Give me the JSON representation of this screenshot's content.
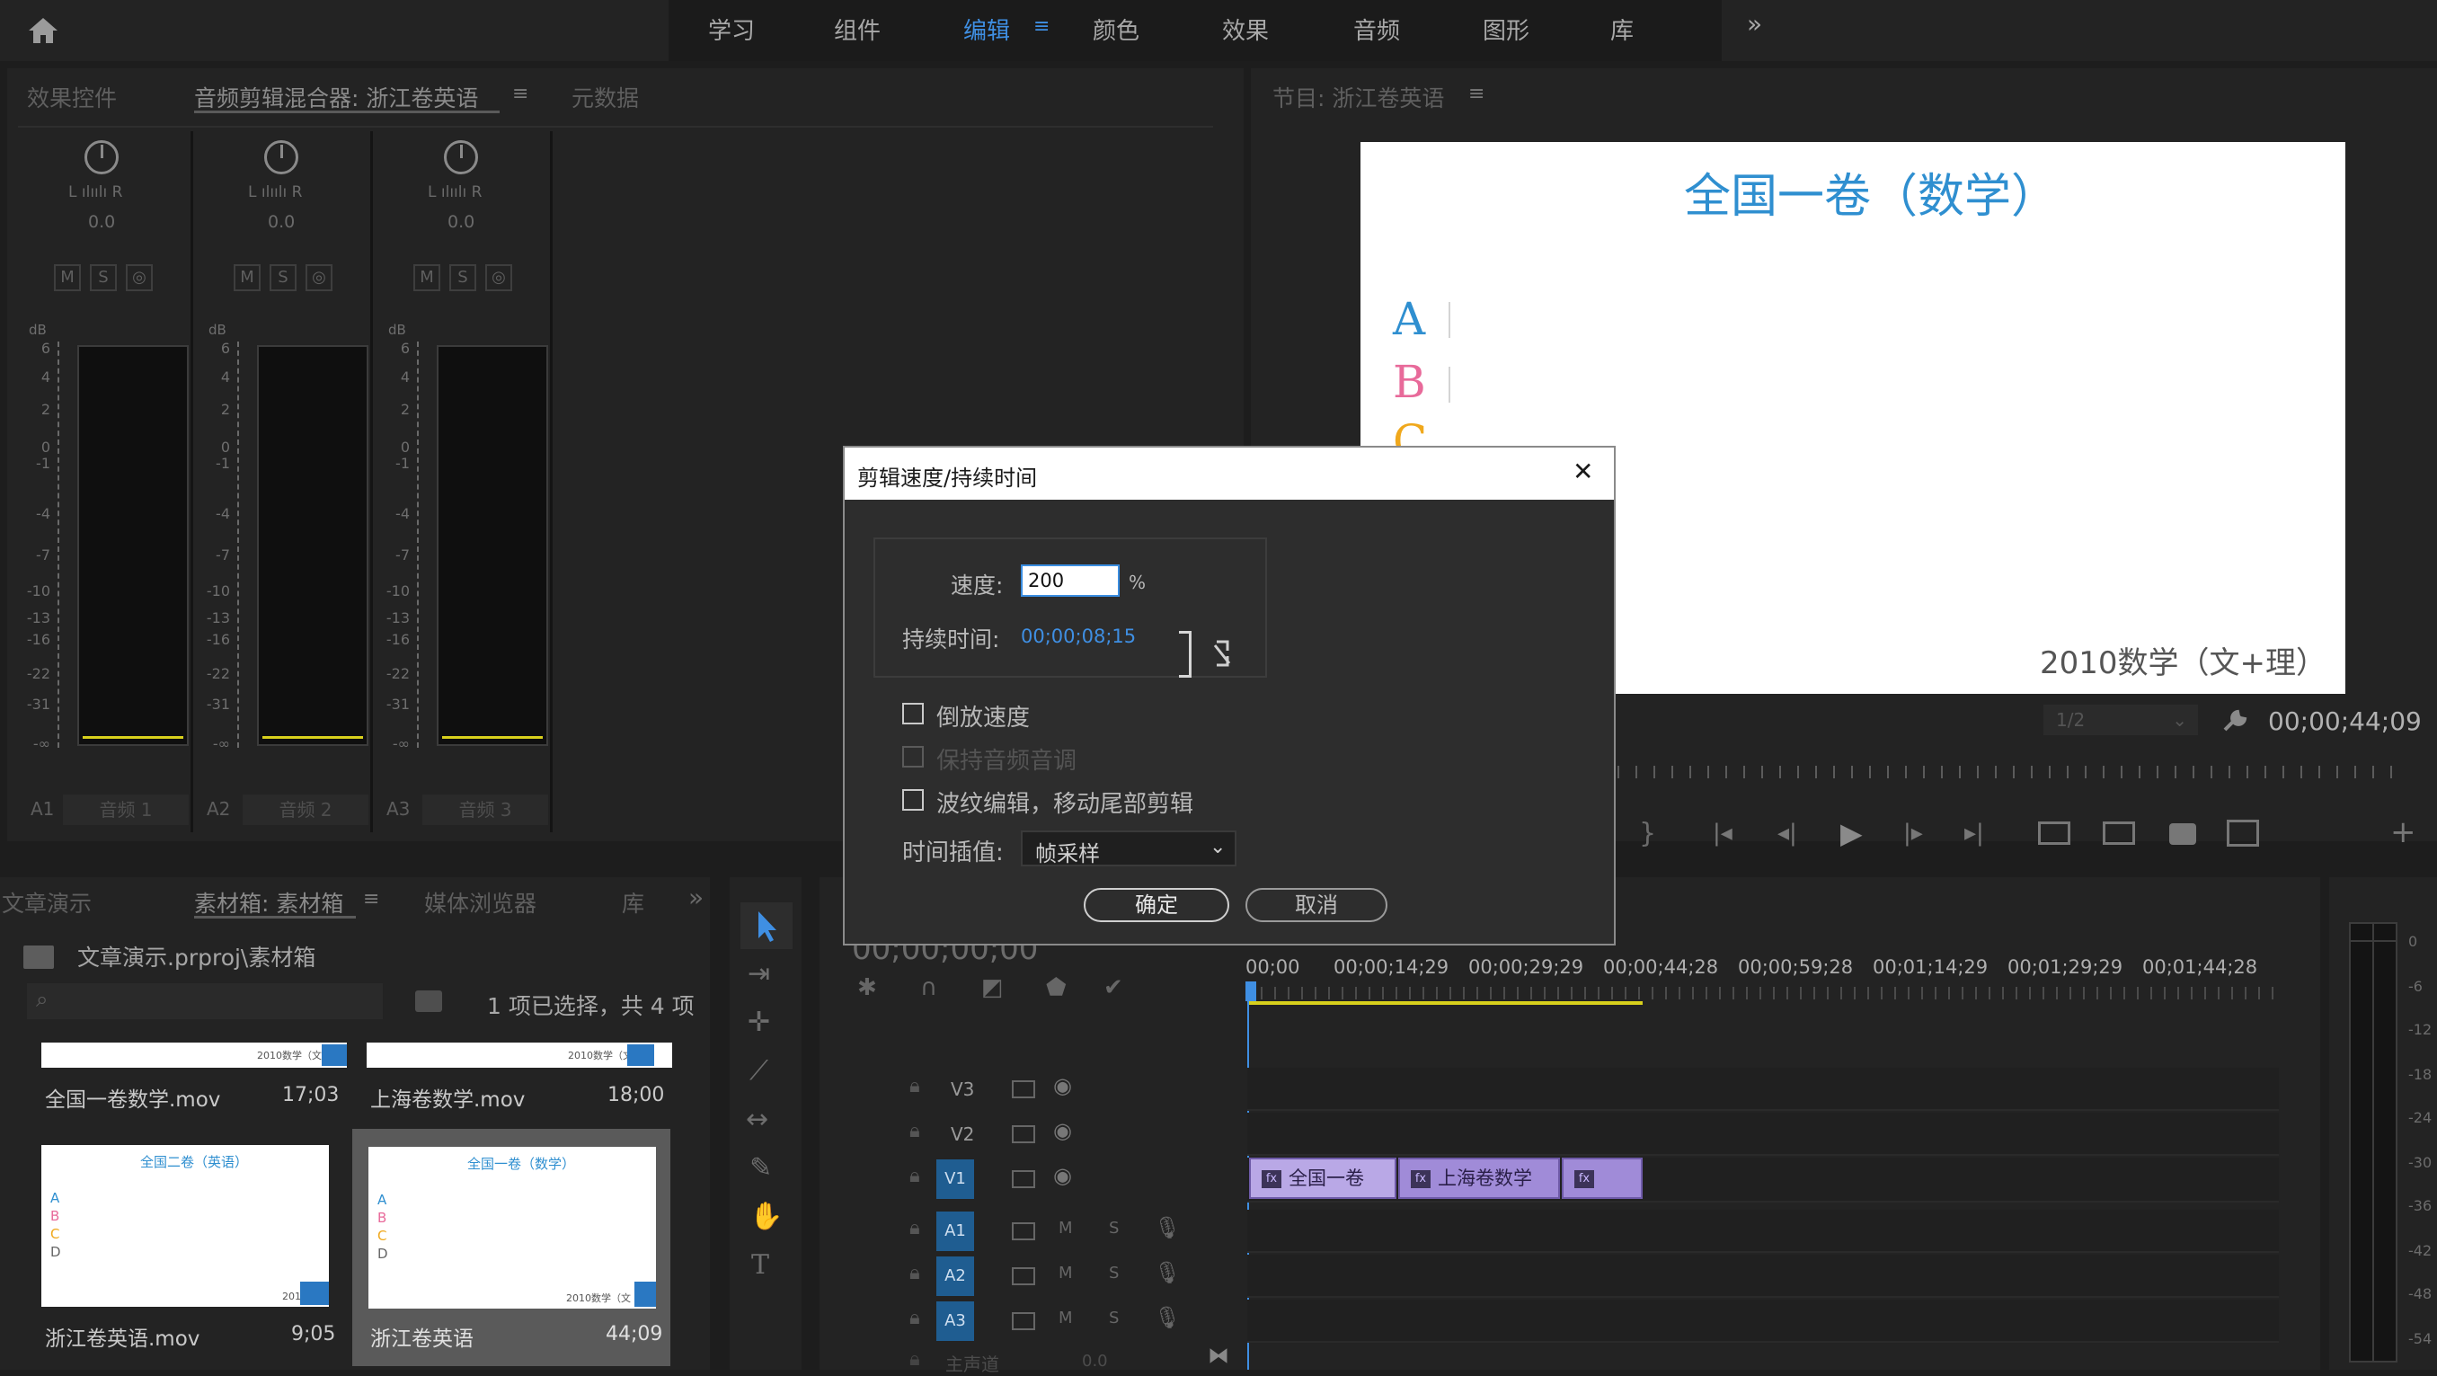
{
  "workspace_tabs": [
    "学习",
    "组件",
    "编辑",
    "颜色",
    "效果",
    "音频",
    "图形",
    "库"
  ],
  "workspace_active": "编辑",
  "workspace_more": "»",
  "left_panel": {
    "tabs": [
      "效果控件",
      "音频剪辑混合器: 浙江卷英语",
      "元数据"
    ],
    "active_tab": "音频剪辑混合器: 浙江卷英语",
    "menu_icon": "≡"
  },
  "mixer": {
    "pan_lr": "L ılıılı R",
    "db_label": "dB",
    "db_scale": [
      "6",
      "4",
      "2",
      "0",
      "-1",
      "-4",
      "-7",
      "-10",
      "-13",
      "-16",
      "-22",
      "-31",
      "-∞"
    ],
    "msr": [
      "M",
      "S",
      "◎"
    ],
    "channels": [
      {
        "pan": "0.0",
        "id": "A1",
        "name": "音频 1"
      },
      {
        "pan": "0.0",
        "id": "A2",
        "name": "音频 2"
      },
      {
        "pan": "0.0",
        "id": "A3",
        "name": "音频 3"
      }
    ]
  },
  "program_monitor": {
    "tab": "节目: 浙江卷英语",
    "menu_icon": "≡",
    "frame_title": "全国一卷（数学）",
    "options": [
      "A",
      "B",
      "C"
    ],
    "option_colors": [
      "#2f8fd0",
      "#e86a9a",
      "#f0a81c"
    ],
    "frame_footer": "2010数学（文+理）",
    "resolution": "1/2",
    "timecode": "00;00;44;09"
  },
  "project_panel": {
    "tabs": [
      "文章演示",
      "素材箱: 素材箱",
      "媒体浏览器",
      "库"
    ],
    "active_tab": "素材箱: 素材箱",
    "path": "文章演示.prproj\\素材箱",
    "search_placeholder": "",
    "selection_status": "1 项已选择，共 4 项",
    "items": [
      {
        "name": "全国一卷数学.mov",
        "duration": "17;03",
        "thumb_footer": "2010数学（文"
      },
      {
        "name": "上海卷数学.mov",
        "duration": "18;00",
        "thumb_footer": "2010数学（文"
      },
      {
        "name": "浙江卷英语.mov",
        "duration": "9;05",
        "thumb_title": "全国二卷（英语）",
        "thumb_options": [
          "A",
          "B",
          "C",
          "D"
        ],
        "thumb_footer": "201"
      },
      {
        "name": "浙江卷英语",
        "duration": "44;09",
        "thumb_title": "全国一卷（数学）",
        "thumb_options": [
          "A",
          "B",
          "C",
          "D"
        ],
        "thumb_footer": "2010数学（文"
      }
    ]
  },
  "timeline": {
    "current_timecode": "00;00;00;00",
    "ruler": [
      "00;00",
      "00;00;14;29",
      "00;00;29;29",
      "00;00;44;28",
      "00;00;59;28",
      "00;01;14;29",
      "00;01;29;29",
      "00;01;44;28"
    ],
    "tracks": [
      "V3",
      "V2",
      "V1",
      "A1",
      "A2",
      "A3"
    ],
    "master_label": "主声道",
    "master_value": "0.0",
    "clips": [
      "全国一卷",
      "上海卷数学",
      "fx"
    ],
    "audio_meter_scale": [
      "0",
      "-6",
      "-12",
      "-18",
      "-24",
      "-30",
      "-36",
      "-42",
      "-48",
      "-54"
    ]
  },
  "dialog": {
    "title": "剪辑速度/持续时间",
    "close": "✕",
    "speed_label": "速度:",
    "speed_value": "200",
    "speed_unit": "%",
    "duration_label": "持续时间:",
    "duration_value": "00;00;08;15",
    "reverse_label": "倒放速度",
    "maintain_pitch_label": "保持音频音调",
    "ripple_label": "波纹编辑，移动尾部剪辑",
    "interp_label": "时间插值:",
    "interp_value": "帧采样",
    "ok_label": "确定",
    "cancel_label": "取消"
  }
}
